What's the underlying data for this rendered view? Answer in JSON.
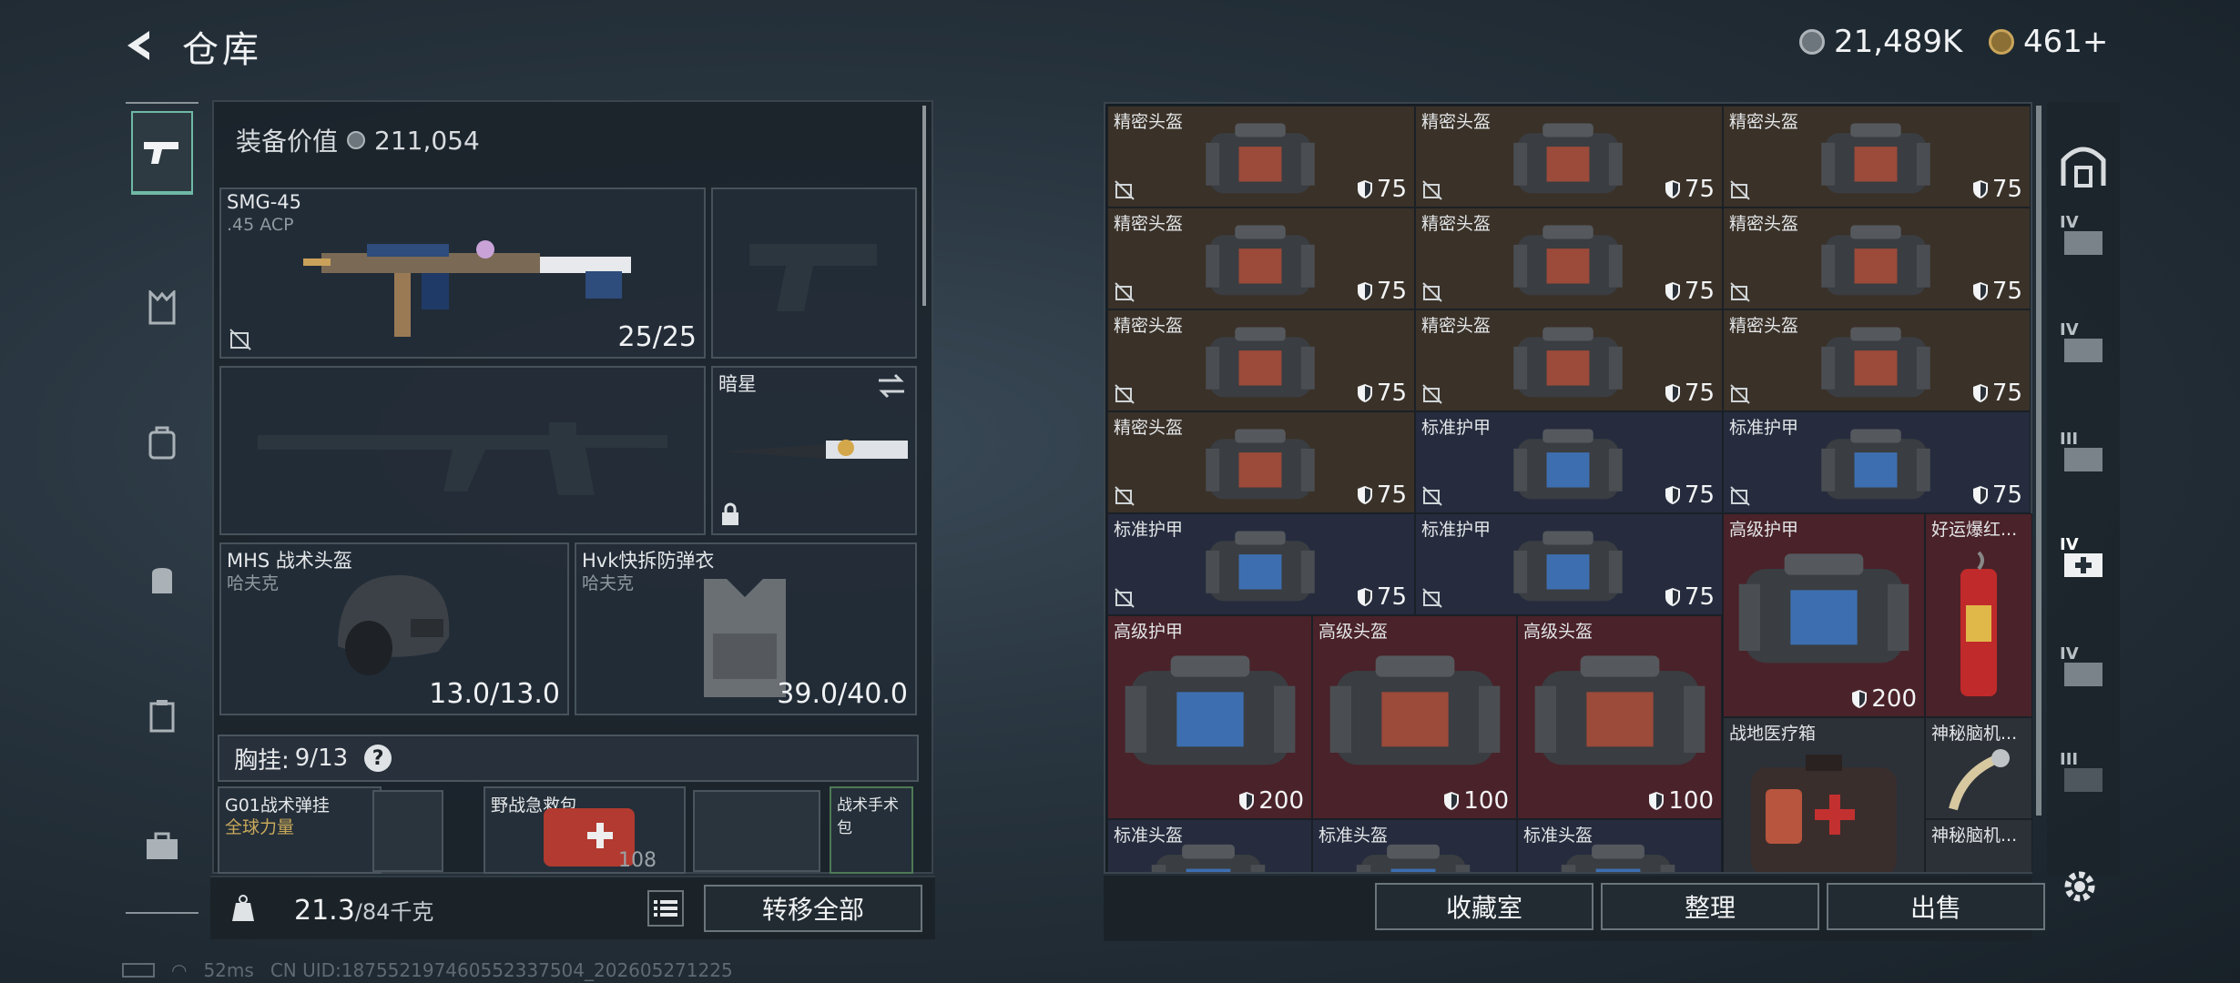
{
  "header": {
    "title": "仓库",
    "silver": "21,489K",
    "gold": "461+"
  },
  "equipment": {
    "value_label": "装备价值",
    "value": "211,054",
    "primary": {
      "name": "SMG-45",
      "ammo": ".45 ACP",
      "count": "25/25"
    },
    "melee": {
      "name": "暗星"
    },
    "helmet": {
      "name": "MHS 战术头盔",
      "brand": "哈夫克",
      "durability": "13.0/13.0"
    },
    "armor": {
      "name": "Hvk快拆防弹衣",
      "brand": "哈夫克",
      "durability": "39.0/40.0"
    },
    "chest": {
      "label": "胸挂:",
      "count": "9/13",
      "help": "?"
    },
    "chest_items": [
      {
        "name": "G01战术弹挂",
        "sub": "全球力量"
      },
      {
        "name": "野战急救包",
        "count": "108"
      },
      {
        "name": "战术手术包"
      }
    ]
  },
  "weight": {
    "current": "21.3",
    "max": "/84千克"
  },
  "transfer_all": "转移全部",
  "storage": {
    "items": [
      {
        "label": "精密头盔",
        "dur": "75",
        "color": "brown"
      },
      {
        "label": "精密头盔",
        "dur": "75",
        "color": "brown"
      },
      {
        "label": "精密头盔",
        "dur": "75",
        "color": "brown"
      },
      {
        "label": "精密头盔",
        "dur": "75",
        "color": "brown"
      },
      {
        "label": "精密头盔",
        "dur": "75",
        "color": "brown"
      },
      {
        "label": "精密头盔",
        "dur": "75",
        "color": "brown"
      },
      {
        "label": "精密头盔",
        "dur": "75",
        "color": "brown"
      },
      {
        "label": "精密头盔",
        "dur": "75",
        "color": "brown"
      },
      {
        "label": "精密头盔",
        "dur": "75",
        "color": "brown"
      },
      {
        "label": "精密头盔",
        "dur": "75",
        "color": "brown"
      },
      {
        "label": "标准护甲",
        "dur": "75",
        "color": "blue"
      },
      {
        "label": "标准护甲",
        "dur": "75",
        "color": "blue"
      },
      {
        "label": "标准护甲",
        "dur": "75",
        "color": "blue"
      },
      {
        "label": "标准护甲",
        "dur": "75",
        "color": "blue"
      }
    ],
    "large_items": [
      {
        "label": "高级护甲",
        "dur": "200"
      },
      {
        "label": "高级护甲",
        "dur": "200"
      },
      {
        "label": "高级头盔",
        "dur": "100"
      },
      {
        "label": "高级头盔",
        "dur": "100"
      }
    ],
    "special_items": [
      {
        "label": "好运爆红..."
      },
      {
        "label": "战地医疗箱"
      },
      {
        "label": "神秘脑机..."
      },
      {
        "label": "神秘脑机..."
      }
    ],
    "bottom_row": [
      {
        "label": "标准头盔"
      },
      {
        "label": "标准头盔"
      },
      {
        "label": "标准头盔"
      }
    ]
  },
  "buttons": {
    "collection": "收藏室",
    "organize": "整理",
    "sell": "出售"
  },
  "right_rail_tiers": [
    "IV",
    "IV",
    "III",
    "IV",
    "IV",
    "III"
  ],
  "status": {
    "ping": "52ms",
    "uid": "CN UID:187552197460552337504_202605271225"
  }
}
